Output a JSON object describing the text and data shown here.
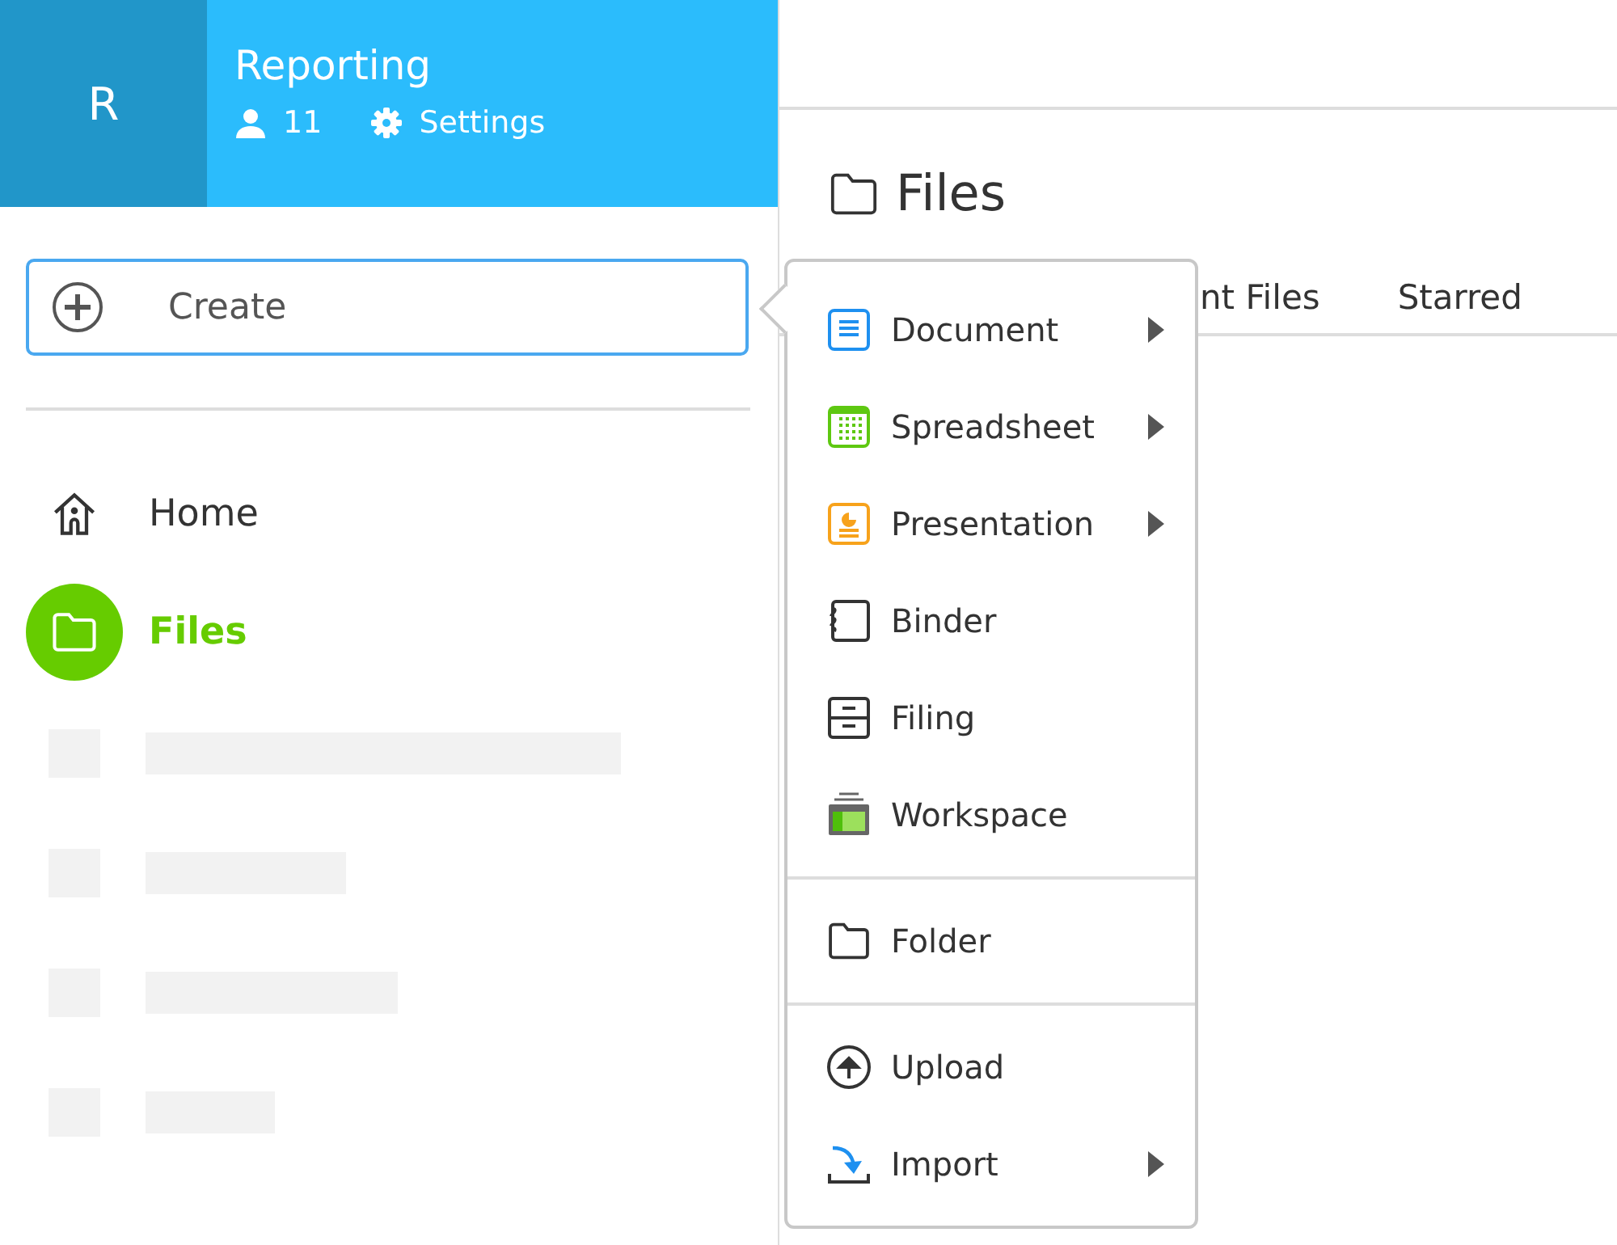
{
  "workspace": {
    "initial": "R",
    "name": "Reporting",
    "members": "11",
    "settings": "Settings"
  },
  "create_button": {
    "label": "Create"
  },
  "nav": [
    {
      "label": "Home",
      "kind": "home",
      "selected": false
    },
    {
      "label": "Files",
      "kind": "files",
      "selected": true
    }
  ],
  "page": {
    "title": "Files",
    "tabs": [
      {
        "label": "nt Files"
      },
      {
        "label": "Starred"
      }
    ]
  },
  "create_menu": {
    "sections": [
      [
        {
          "label": "Document",
          "kind": "document",
          "submenu": true
        },
        {
          "label": "Spreadsheet",
          "kind": "spreadsheet",
          "submenu": true
        },
        {
          "label": "Presentation",
          "kind": "presentation",
          "submenu": true
        },
        {
          "label": "Binder",
          "kind": "binder",
          "submenu": false
        },
        {
          "label": "Filing",
          "kind": "filing",
          "submenu": false
        },
        {
          "label": "Workspace",
          "kind": "workspace",
          "submenu": false
        }
      ],
      [
        {
          "label": "Folder",
          "kind": "folder",
          "submenu": false
        }
      ],
      [
        {
          "label": "Upload",
          "kind": "upload",
          "submenu": false
        },
        {
          "label": "Import",
          "kind": "import",
          "submenu": true
        }
      ]
    ]
  }
}
